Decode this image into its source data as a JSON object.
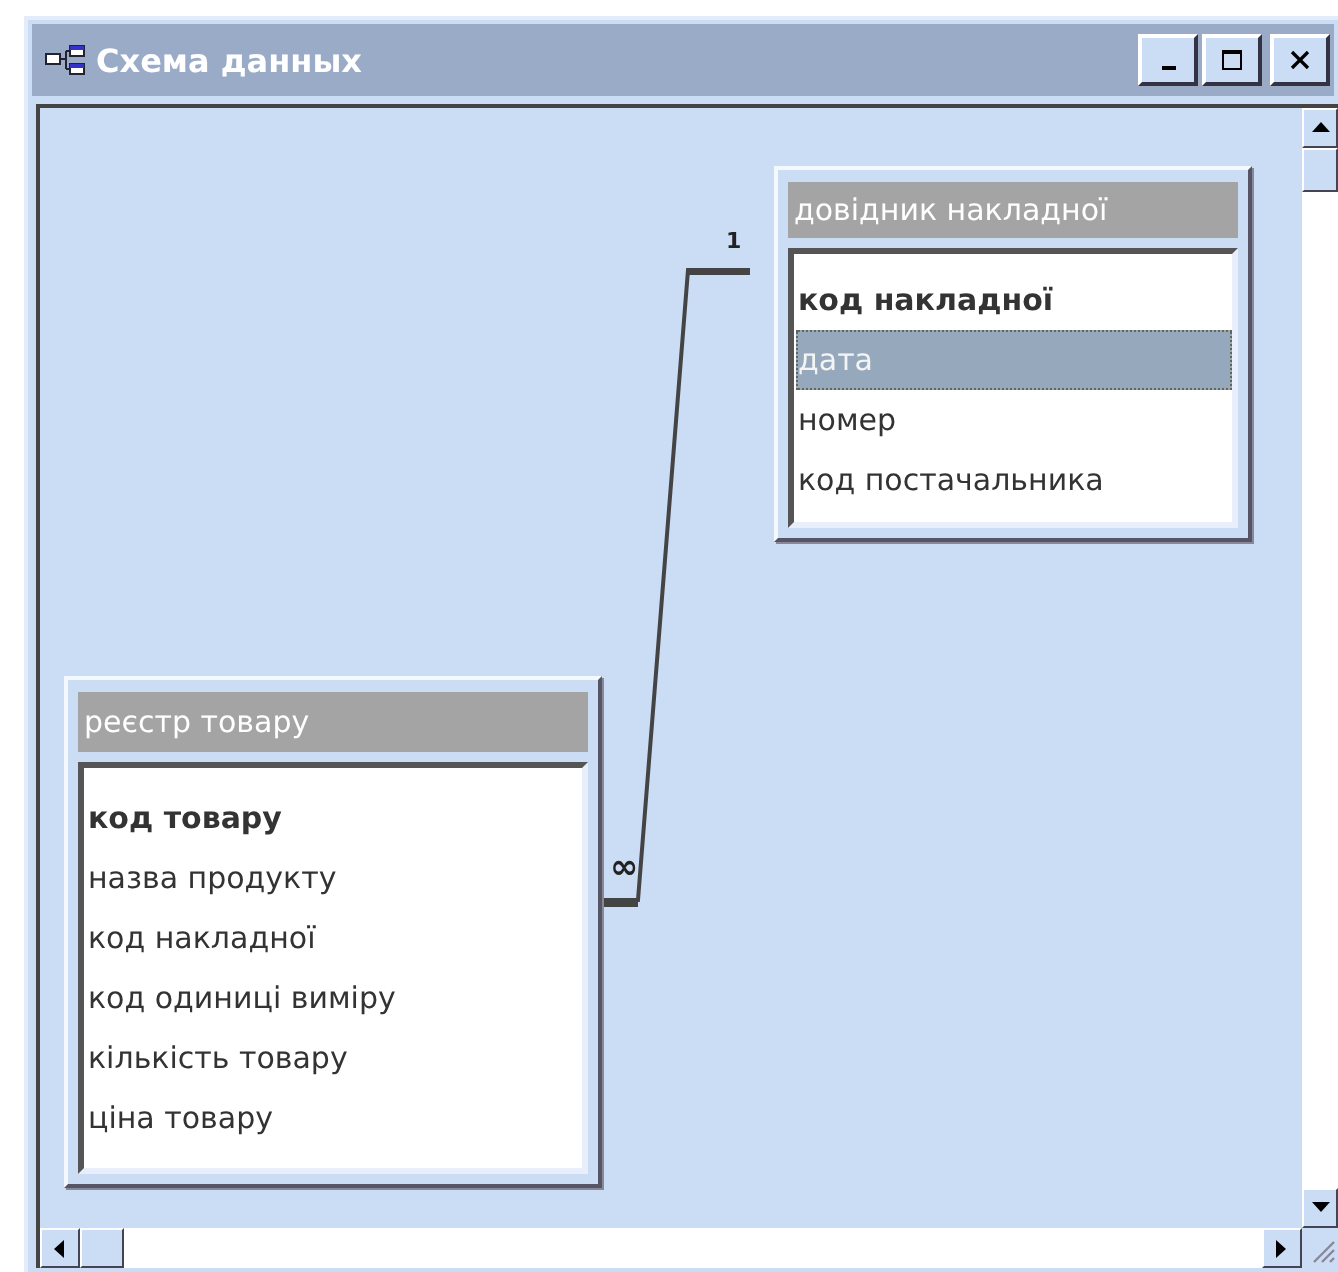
{
  "window": {
    "title": "Схема данных"
  },
  "tables": [
    {
      "title": "довідник накладної",
      "fields": [
        {
          "name": "код накладної",
          "key": true,
          "selected": false
        },
        {
          "name": "дата",
          "key": false,
          "selected": true
        },
        {
          "name": "номер",
          "key": false,
          "selected": false
        },
        {
          "name": "код постачальника",
          "key": false,
          "selected": false
        }
      ]
    },
    {
      "title": "реєстр товару",
      "fields": [
        {
          "name": "код товару",
          "key": true,
          "selected": false
        },
        {
          "name": "назва продукту",
          "key": false,
          "selected": false
        },
        {
          "name": "код накладної",
          "key": false,
          "selected": false
        },
        {
          "name": "код одиниці виміру",
          "key": false,
          "selected": false
        },
        {
          "name": "кількість товару",
          "key": false,
          "selected": false
        },
        {
          "name": "ціна товару",
          "key": false,
          "selected": false
        }
      ]
    }
  ],
  "relationship": {
    "one_label": "1",
    "many_label": "∞"
  }
}
